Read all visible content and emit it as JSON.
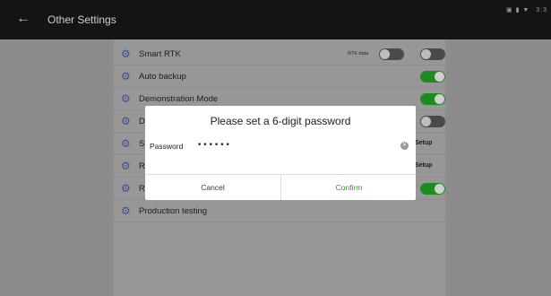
{
  "header": {
    "title": "Other Settings",
    "back_icon": "arrow-left-icon",
    "status_time": "3:3",
    "status_icons": "▣ ▮ ▼"
  },
  "settings": {
    "items": [
      {
        "label": "Smart RTK",
        "toggle": "off",
        "extra_label": "RTK data",
        "extra_toggle": "off"
      },
      {
        "label": "Auto backup",
        "toggle": "on"
      },
      {
        "label": "Demonstration Mode",
        "toggle": "on"
      },
      {
        "label": "D",
        "toggle": "off"
      },
      {
        "label": "S",
        "action": "Setup"
      },
      {
        "label": "R",
        "action": "Setup"
      },
      {
        "label": "R",
        "toggle": "on"
      },
      {
        "label": "Production testing"
      }
    ]
  },
  "dialog": {
    "title": "Please set a 6-digit password",
    "password_label": "Password",
    "password_value": "••••••",
    "cancel_label": "Cancel",
    "confirm_label": "Confirm"
  },
  "colors": {
    "toggle_on": "#1f8a1f",
    "confirm_text": "#2e9a2e",
    "gear_icon": "#3d4f8c"
  }
}
